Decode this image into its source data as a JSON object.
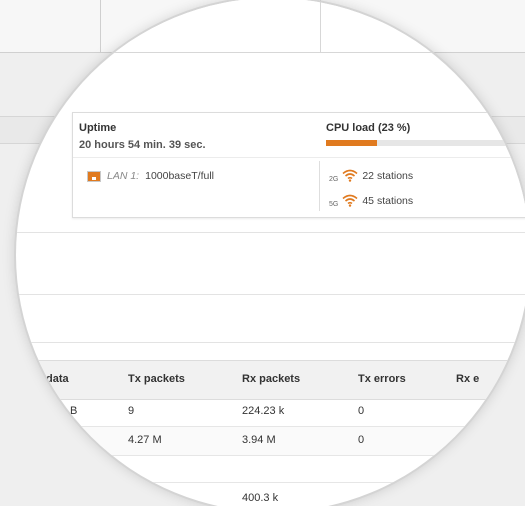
{
  "status_panel": {
    "uptime_title": "Uptime",
    "uptime_value": "20 hours 54 min. 39 sec.",
    "cpu_title": "CPU load (23 %)",
    "cpu_load_percent": 23,
    "lan_label": "LAN 1:",
    "lan_speed": "1000baseT/full",
    "wifi": [
      {
        "band": "2G",
        "stations": "22 stations"
      },
      {
        "band": "5G",
        "stations": "45 stations"
      }
    ]
  },
  "table": {
    "headers": [
      "data",
      "Tx packets",
      "Rx packets",
      "Tx errors",
      "Rx e"
    ],
    "rows": [
      [
        "B",
        "9",
        "224.23 k",
        "0"
      ],
      [
        "",
        "4.27 M",
        "3.94 M",
        "0"
      ],
      [
        "",
        "",
        "400.3 k",
        ""
      ]
    ]
  },
  "colors": {
    "accent": "#e07a1f",
    "panel_border": "#dcdcdc",
    "table_header_bg": "#f1f1f1"
  }
}
